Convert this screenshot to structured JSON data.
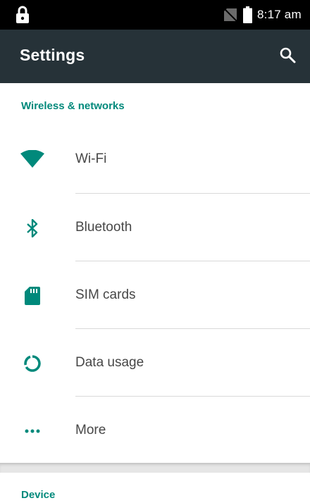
{
  "status_bar": {
    "time": "8:17 am",
    "icons": [
      "lock-icon",
      "no-sim-icon",
      "battery-icon"
    ]
  },
  "toolbar": {
    "title": "Settings",
    "search_icon": "search-icon"
  },
  "sections": [
    {
      "header": "Wireless & networks",
      "items": [
        {
          "label": "Wi-Fi",
          "icon": "wifi-icon"
        },
        {
          "label": "Bluetooth",
          "icon": "bluetooth-icon"
        },
        {
          "label": "SIM cards",
          "icon": "sim-card-icon"
        },
        {
          "label": "Data usage",
          "icon": "data-usage-icon"
        },
        {
          "label": "More",
          "icon": "more-icon"
        }
      ]
    },
    {
      "header": "Device",
      "items": []
    }
  ],
  "colors": {
    "accent": "#00897b",
    "toolbar": "#263238",
    "status_bar": "#000000",
    "label_text": "#474747"
  }
}
